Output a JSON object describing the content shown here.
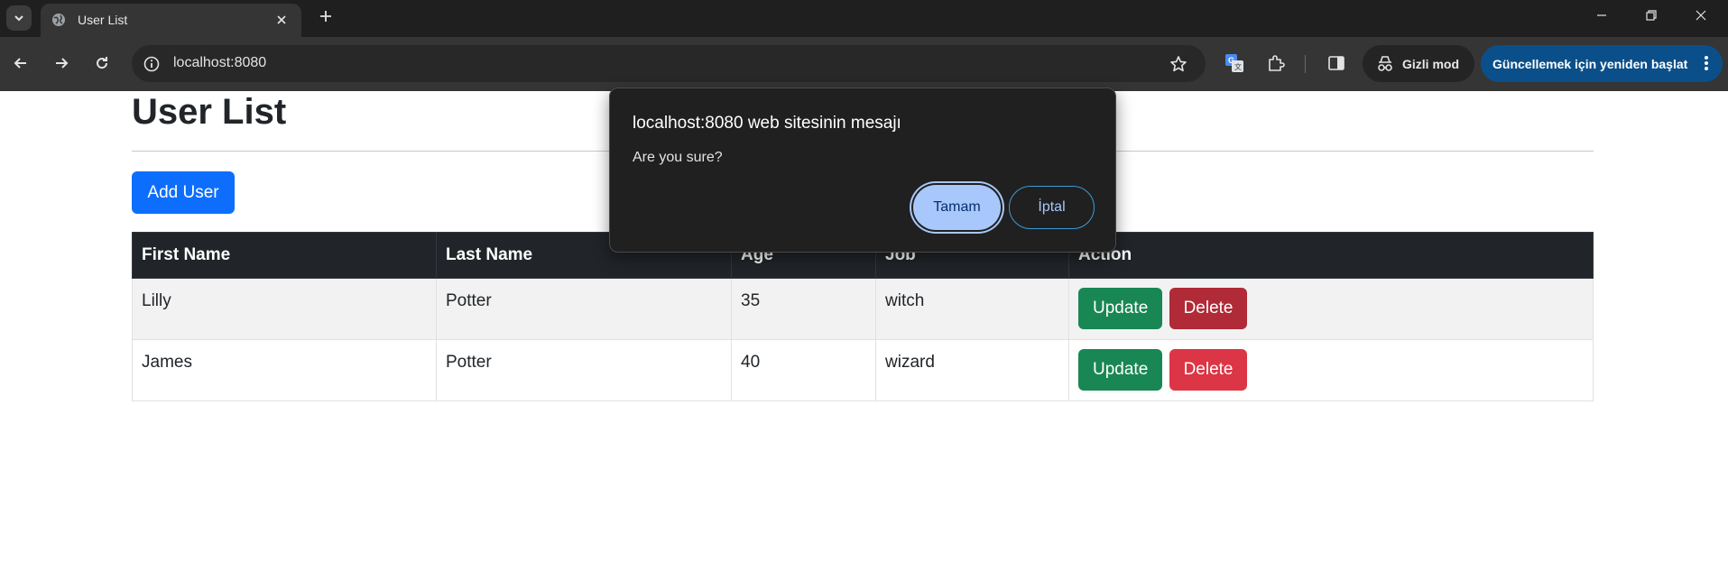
{
  "browser": {
    "tab": {
      "title": "User List"
    },
    "omnibox": {
      "url": "localhost:8080"
    },
    "incognito_label": "Gizli mod",
    "relaunch_label": "Güncellemek için yeniden başlat",
    "accent": "#a8c7fa",
    "relaunch_color": "#0b4f8a"
  },
  "page": {
    "title": "User List",
    "add_button": "Add User",
    "table": {
      "headers": [
        "First Name",
        "Last Name",
        "Age",
        "Job",
        "Action"
      ],
      "rows": [
        {
          "first": "Lilly",
          "last": "Potter",
          "age": "35",
          "job": "witch",
          "update": "Update",
          "delete": "Delete"
        },
        {
          "first": "James",
          "last": "Potter",
          "age": "40",
          "job": "wizard",
          "update": "Update",
          "delete": "Delete"
        }
      ]
    },
    "colors": {
      "primary": "#0d6efd",
      "success": "#198754",
      "danger": "#dc3545",
      "header_bg": "#212529"
    }
  },
  "dialog": {
    "title": "localhost:8080 web sitesinin mesajı",
    "message": "Are you sure?",
    "ok_label": "Tamam",
    "cancel_label": "İptal"
  }
}
